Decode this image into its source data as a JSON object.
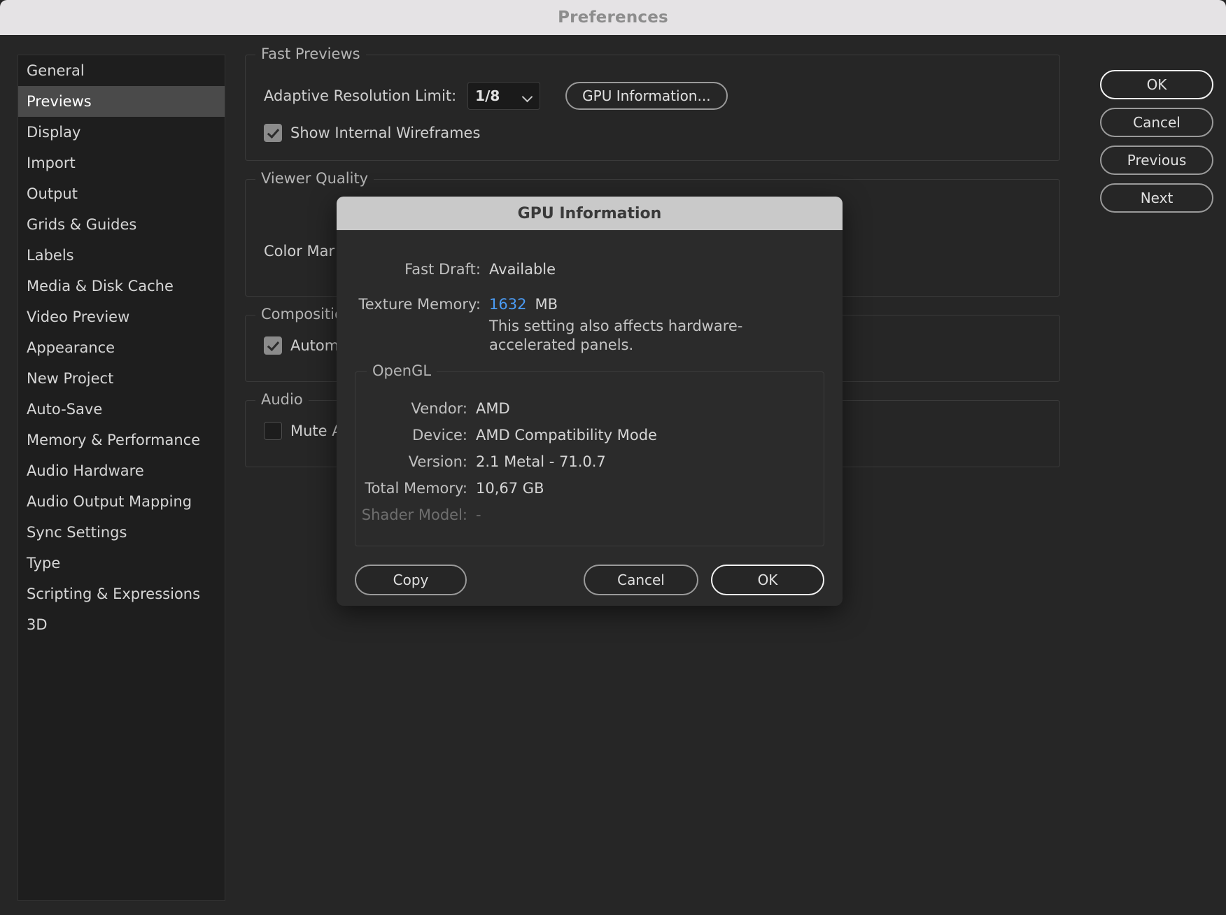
{
  "window": {
    "title": "Preferences"
  },
  "sidebar": {
    "items": [
      {
        "label": "General",
        "selected": false
      },
      {
        "label": "Previews",
        "selected": true
      },
      {
        "label": "Display",
        "selected": false
      },
      {
        "label": "Import",
        "selected": false
      },
      {
        "label": "Output",
        "selected": false
      },
      {
        "label": "Grids & Guides",
        "selected": false
      },
      {
        "label": "Labels",
        "selected": false
      },
      {
        "label": "Media & Disk Cache",
        "selected": false
      },
      {
        "label": "Video Preview",
        "selected": false
      },
      {
        "label": "Appearance",
        "selected": false
      },
      {
        "label": "New Project",
        "selected": false
      },
      {
        "label": "Auto-Save",
        "selected": false
      },
      {
        "label": "Memory & Performance",
        "selected": false
      },
      {
        "label": "Audio Hardware",
        "selected": false
      },
      {
        "label": "Audio Output Mapping",
        "selected": false
      },
      {
        "label": "Sync Settings",
        "selected": false
      },
      {
        "label": "Type",
        "selected": false
      },
      {
        "label": "Scripting & Expressions",
        "selected": false
      },
      {
        "label": "3D",
        "selected": false
      }
    ]
  },
  "panels": {
    "fast_previews": {
      "title": "Fast Previews",
      "adaptive_resolution_label": "Adaptive Resolution Limit:",
      "adaptive_resolution_value": "1/8",
      "gpu_info_button": "GPU Information...",
      "wireframes_label": "Show Internal Wireframes",
      "wireframes_checked": true
    },
    "viewer_quality": {
      "title": "Viewer Quality",
      "color_management_label": "Color Mar"
    },
    "composition_switches": {
      "title": "Composition Swit",
      "automatic_label": "Automaticall",
      "automatic_checked": true
    },
    "audio": {
      "title": "Audio",
      "mute_label": "Mute Audio",
      "mute_checked": false
    }
  },
  "side_buttons": [
    {
      "label": "OK",
      "primary": true
    },
    {
      "label": "Cancel",
      "primary": false
    },
    {
      "label": "Previous",
      "primary": false
    },
    {
      "label": "Next",
      "primary": false
    }
  ],
  "gpu_modal": {
    "title": "GPU Information",
    "fast_draft_key": "Fast Draft:",
    "fast_draft_value": "Available",
    "texture_memory_key": "Texture Memory:",
    "texture_memory_value": "1632",
    "texture_memory_unit": "MB",
    "texture_note": "This setting also affects hardware-accelerated panels.",
    "opengl_title": "OpenGL",
    "rows": [
      {
        "key": "Vendor:",
        "value": "AMD",
        "dim": false
      },
      {
        "key": "Device:",
        "value": "AMD Compatibility Mode",
        "dim": false
      },
      {
        "key": "Version:",
        "value": "2.1 Metal - 71.0.7",
        "dim": false
      },
      {
        "key": "Total Memory:",
        "value": "10,67 GB",
        "dim": false
      },
      {
        "key": "Shader Model:",
        "value": "-",
        "dim": true
      }
    ],
    "copy_button": "Copy",
    "cancel_button": "Cancel",
    "ok_button": "OK"
  },
  "colors": {
    "accent_blue": "#4b9cf5",
    "window_bg": "#262626",
    "titlebar_bg": "#e5e3e5",
    "selected_item": "#4a4a4a"
  }
}
